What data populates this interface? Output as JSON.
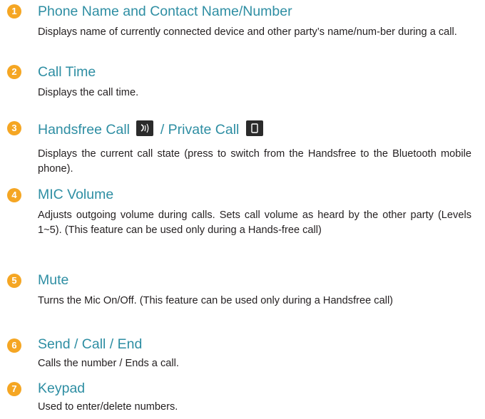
{
  "items": [
    {
      "number": "1",
      "title": "Phone Name and Contact Name/Number",
      "desc": "Displays name of currently connected device and other party’s name/num-ber during a call."
    },
    {
      "number": "2",
      "title": "Call Time",
      "desc": "Displays the call time."
    },
    {
      "number": "3",
      "title_a": "Handsfree Call",
      "title_sep": " / ",
      "title_b": "Private Call",
      "icon_a": "handsfree-call-icon",
      "icon_b": "private-call-phone-icon",
      "desc": "Displays the current call state (press to switch from the Handsfree to the Bluetooth mobile phone)."
    },
    {
      "number": "4",
      "title": "MIC Volume",
      "desc": "Adjusts outgoing volume during calls. Sets call volume as heard by the other party (Levels 1~5). (This feature can be used only during a Hands-free call)"
    },
    {
      "number": "5",
      "title": "Mute",
      "desc": "Turns the Mic On/Off. (This feature can be used only during a Handsfree call)"
    },
    {
      "number": "6",
      "title": "Send / Call / End",
      "desc": "Calls the number / Ends a call."
    },
    {
      "number": "7",
      "title": "Keypad",
      "desc": "Used to enter/delete numbers."
    }
  ],
  "colors": {
    "accent": "#f5a623",
    "title": "#2e8ea3",
    "text": "#231f20",
    "icon_bg": "#2b2b2b"
  }
}
